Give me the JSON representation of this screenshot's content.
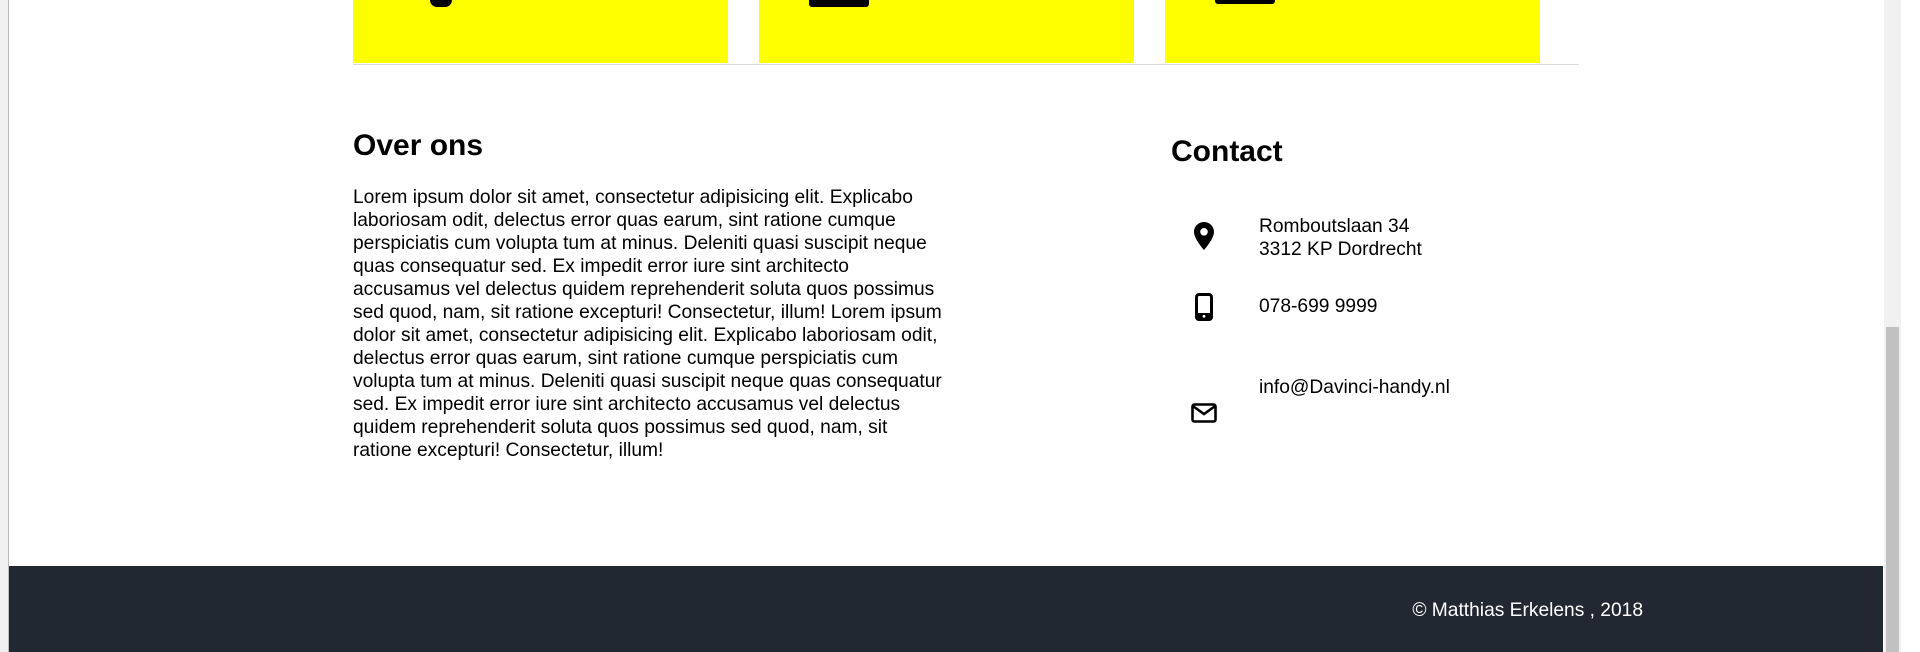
{
  "about": {
    "title": "Over ons",
    "body": "Lorem ipsum dolor sit amet, consectetur adipisicing elit. Explicabo laboriosam odit, delectus error quas earum, sint ratione cumque perspiciatis cum volupta tum at minus. Deleniti quasi suscipit neque quas consequatur sed. Ex impedit error iure sint architecto accusamus vel delectus quidem reprehenderit soluta quos possimus sed quod, nam, sit ratione excepturi! Consectetur, illum! Lorem ipsum dolor sit amet, consectetur adipisicing elit. Explicabo laboriosam odit, delectus error quas earum, sint ratione cumque perspiciatis cum volupta tum at minus. Deleniti quasi suscipit neque quas consequatur sed. Ex impedit error iure sint architecto accusamus vel delectus quidem reprehenderit soluta quos possimus sed quod, nam, sit ratione excepturi! Consectetur, illum!"
  },
  "contact": {
    "title": "Contact",
    "address_line1": "Romboutslaan 34",
    "address_line2": "3312 KP Dordrecht",
    "phone": "078-699 9999",
    "email": "info@Davinci-handy.nl",
    "icons": {
      "address": "map-marker-icon",
      "phone": "mobile-phone-icon",
      "email": "envelope-icon"
    }
  },
  "footer": {
    "copyright": "© Matthias Erkelens , 2018"
  },
  "colors": {
    "card_yellow": "#ffff00",
    "footer_bg": "#212831",
    "footer_text": "#ffffff"
  }
}
